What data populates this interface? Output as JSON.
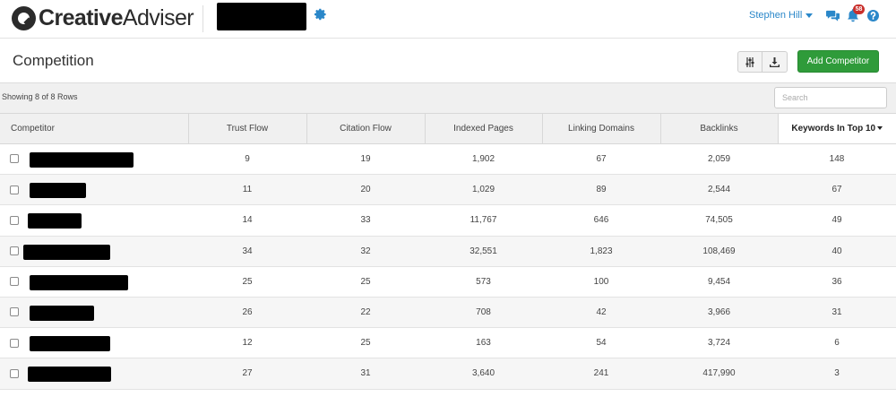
{
  "brand": {
    "name_bold": "Creative",
    "name_light": "Adviser"
  },
  "user": {
    "name": "Stephen Hill"
  },
  "notifications": {
    "count": "58"
  },
  "page": {
    "title": "Competition",
    "add_label": "Add Competitor"
  },
  "table": {
    "row_count": "Showing 8 of 8 Rows",
    "search_placeholder": "Search",
    "columns": [
      "Competitor",
      "Trust Flow",
      "Citation Flow",
      "Indexed Pages",
      "Linking Domains",
      "Backlinks",
      "Keywords In Top 10"
    ],
    "sorted_column": "Keywords In Top 10",
    "rows": [
      {
        "trust_flow": "9",
        "citation_flow": "19",
        "indexed_pages": "1,902",
        "linking_domains": "67",
        "backlinks": "2,059",
        "keywords_top10": "148"
      },
      {
        "trust_flow": "11",
        "citation_flow": "20",
        "indexed_pages": "1,029",
        "linking_domains": "89",
        "backlinks": "2,544",
        "keywords_top10": "67"
      },
      {
        "trust_flow": "14",
        "citation_flow": "33",
        "indexed_pages": "11,767",
        "linking_domains": "646",
        "backlinks": "74,505",
        "keywords_top10": "49"
      },
      {
        "trust_flow": "34",
        "citation_flow": "32",
        "indexed_pages": "32,551",
        "linking_domains": "1,823",
        "backlinks": "108,469",
        "keywords_top10": "40"
      },
      {
        "trust_flow": "25",
        "citation_flow": "25",
        "indexed_pages": "573",
        "linking_domains": "100",
        "backlinks": "9,454",
        "keywords_top10": "36"
      },
      {
        "trust_flow": "26",
        "citation_flow": "22",
        "indexed_pages": "708",
        "linking_domains": "42",
        "backlinks": "3,966",
        "keywords_top10": "31"
      },
      {
        "trust_flow": "12",
        "citation_flow": "25",
        "indexed_pages": "163",
        "linking_domains": "54",
        "backlinks": "3,724",
        "keywords_top10": "6"
      },
      {
        "trust_flow": "27",
        "citation_flow": "31",
        "indexed_pages": "3,640",
        "linking_domains": "241",
        "backlinks": "417,990",
        "keywords_top10": "3"
      }
    ]
  },
  "colors": {
    "accent": "#2a87c9",
    "add_button": "#2f9b3a",
    "badge": "#c9302c"
  },
  "icons": [
    "gear-icon",
    "chat-icon",
    "bell-icon",
    "help-icon",
    "filter-sliders-icon",
    "download-icon",
    "sort-caret-icon"
  ]
}
